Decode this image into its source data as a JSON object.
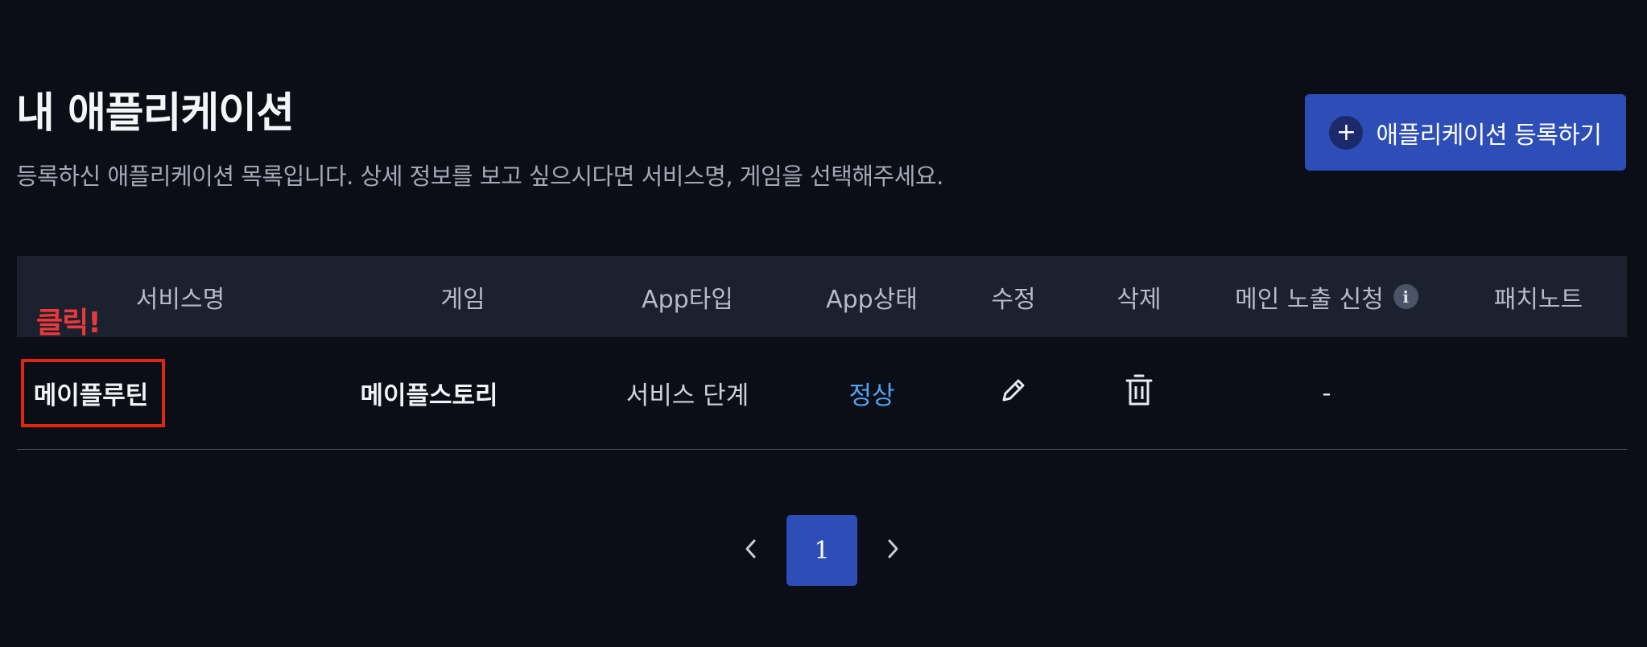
{
  "header": {
    "title": "내 애플리케이션",
    "description": "등록하신 애플리케이션 목록입니다. 상세 정보를 보고 싶으시다면 서비스명, 게임을 선택해주세요.",
    "register_button": {
      "icon": "plus-icon",
      "plus_glyph": "+",
      "label": "애플리케이션 등록하기"
    }
  },
  "table": {
    "columns": [
      "서비스명",
      "게임",
      "App타입",
      "App상태",
      "수정",
      "삭제",
      "메인 노출 신청",
      "패치노트"
    ],
    "info_icon_glyph": "i",
    "rows": [
      {
        "service": "메이플루틴",
        "game": "메이플스토리",
        "app_type": "서비스 단계",
        "app_status": "정상",
        "edit_icon": "pencil-icon",
        "delete_icon": "trash-icon",
        "main_exposure": "-"
      }
    ]
  },
  "annotation": {
    "click_note": "클릭!"
  },
  "pagination": {
    "current_page": "1"
  },
  "colors": {
    "accent": "#2d4db7",
    "status_ok": "#4fa3f0",
    "annotation_red": "#e0260e"
  }
}
